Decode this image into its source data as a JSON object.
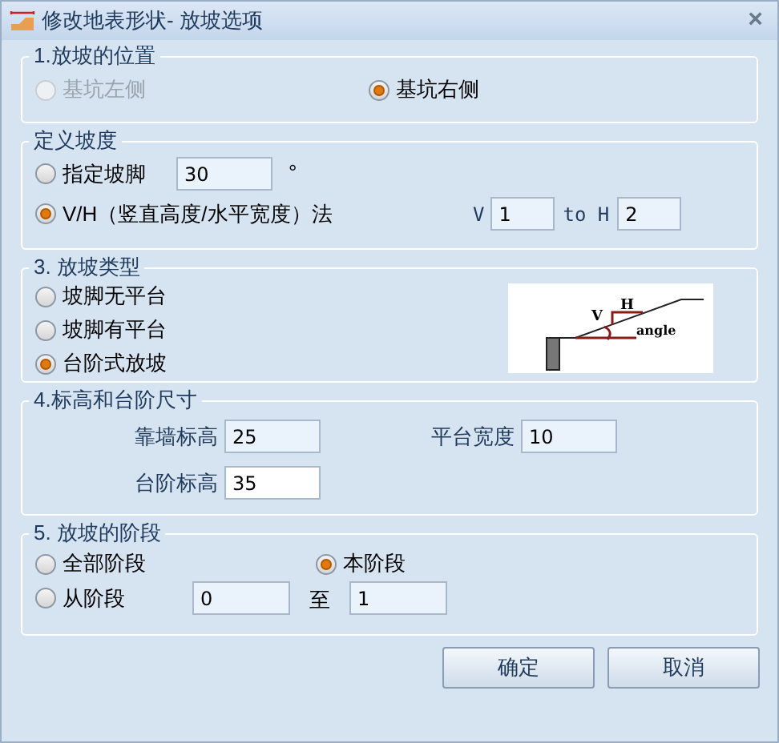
{
  "window": {
    "title": "修改地表形状- 放坡选项",
    "close": "×"
  },
  "position": {
    "title": "1.放坡的位置",
    "options": [
      {
        "label": "基坑左侧",
        "selected": false,
        "disabled": true
      },
      {
        "label": "基坑右侧",
        "selected": true,
        "disabled": false
      }
    ]
  },
  "slope": {
    "title": "定义坡度",
    "angle_option": {
      "label": "指定坡脚",
      "selected": false
    },
    "angle_value": "30",
    "degree": "°",
    "ratio_option": {
      "label": "V/H（竖直高度/水平宽度）法",
      "selected": true
    },
    "v_label": "V",
    "v_value": "1",
    "h_label": "to H",
    "h_value": "2"
  },
  "type": {
    "title": "3. 放坡类型",
    "options": [
      {
        "label": "坡脚无平台",
        "selected": false
      },
      {
        "label": "坡脚有平台",
        "selected": false
      },
      {
        "label": "台阶式放坡",
        "selected": true
      }
    ],
    "diagram": {
      "v": "V",
      "h": "H",
      "angle": "angle"
    }
  },
  "sizes": {
    "title": "4.标高和台阶尺寸",
    "wall_label": "靠墙标高",
    "wall_value": "25",
    "platform_label": "平台宽度",
    "platform_value": "10",
    "step_label": "台阶标高",
    "step_value": "35"
  },
  "stages": {
    "title": "5. 放坡的阶段",
    "all": {
      "label": "全部阶段",
      "selected": false
    },
    "current": {
      "label": "本阶段",
      "selected": true
    },
    "from": {
      "label": "从阶段",
      "selected": false
    },
    "from_value": "0",
    "to_label": "至",
    "to_value": "1"
  },
  "buttons": [
    "确定",
    "取消"
  ]
}
